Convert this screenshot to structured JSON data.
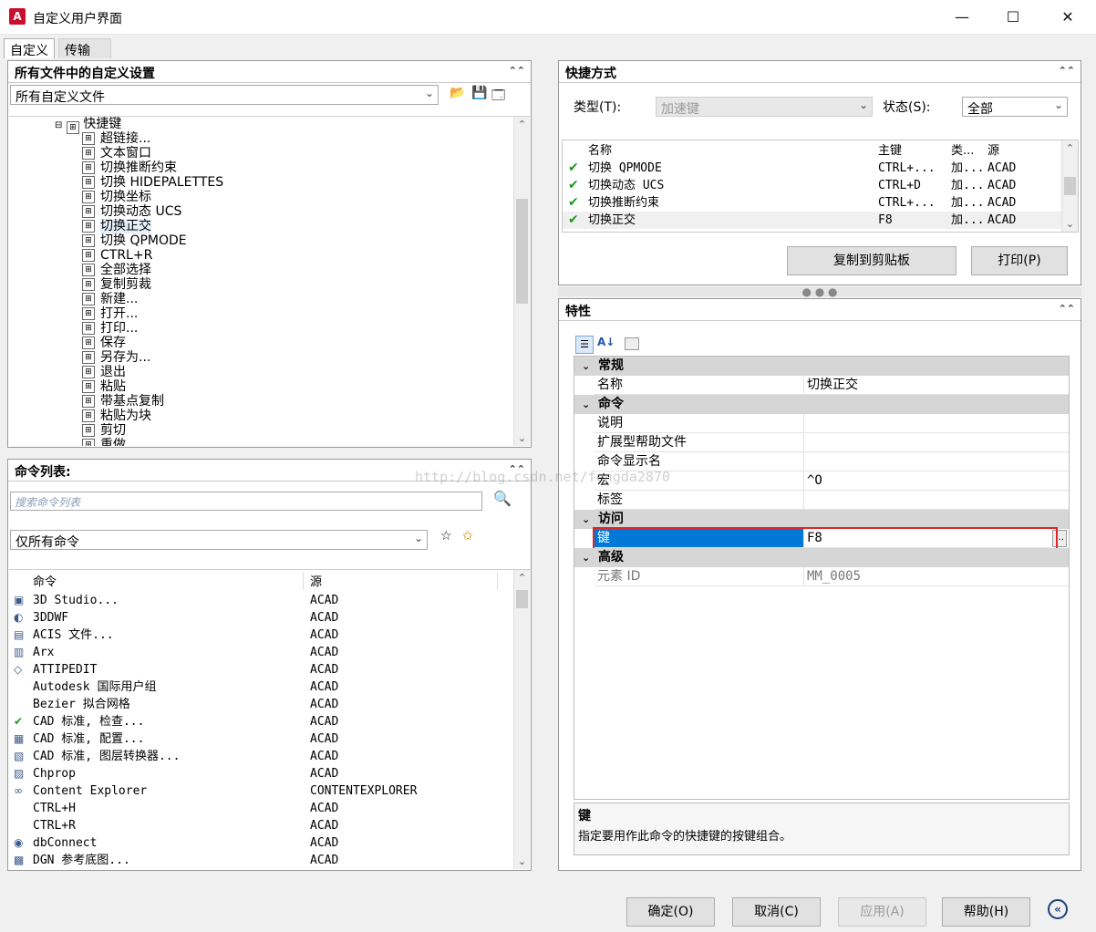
{
  "window": {
    "title": "自定义用户界面"
  },
  "tabs": [
    {
      "label": "自定义"
    },
    {
      "label": "传输"
    }
  ],
  "customizations": {
    "header": "所有文件中的自定义设置",
    "filter_value": "所有自定义文件",
    "tree_root": "快捷键",
    "tree_items": [
      "超链接...",
      "文本窗口",
      "切换推断约束",
      "切换 HIDEPALETTES",
      "切换坐标",
      "切换动态 UCS",
      "切换正交",
      "切换 QPMODE",
      "CTRL+R",
      "全部选择",
      "复制剪裁",
      "新建...",
      "打开...",
      "打印...",
      "保存",
      "另存为...",
      "退出",
      "粘贴",
      "带基点复制",
      "粘贴为块",
      "剪切",
      "重做"
    ]
  },
  "command_list": {
    "header": "命令列表:",
    "search_placeholder": "搜索命令列表",
    "filter_value": "仅所有命令",
    "col_command": "命令",
    "col_source": "源",
    "rows": [
      {
        "name": "3D Studio...",
        "source": "ACAD",
        "icon": "3dstudio-icon"
      },
      {
        "name": "3DDWF",
        "source": "ACAD",
        "icon": "3ddwf-icon"
      },
      {
        "name": "ACIS 文件...",
        "source": "ACAD",
        "icon": "acis-icon"
      },
      {
        "name": "Arx",
        "source": "ACAD",
        "icon": "arx-icon"
      },
      {
        "name": "ATTIPEDIT",
        "source": "ACAD",
        "icon": "attipedit-icon"
      },
      {
        "name": "Autodesk 国际用户组",
        "source": "ACAD",
        "icon": ""
      },
      {
        "name": "Bezier 拟合网格",
        "source": "ACAD",
        "icon": ""
      },
      {
        "name": "CAD 标准, 检查...",
        "source": "ACAD",
        "icon": "check-icon"
      },
      {
        "name": "CAD 标准, 配置...",
        "source": "ACAD",
        "icon": "configure-icon"
      },
      {
        "name": "CAD 标准, 图层转换器...",
        "source": "ACAD",
        "icon": "layer-translator-icon"
      },
      {
        "name": "Chprop",
        "source": "ACAD",
        "icon": "chprop-icon"
      },
      {
        "name": "Content Explorer",
        "source": "CONTENTEXPLORER",
        "icon": "binoculars-icon"
      },
      {
        "name": "CTRL+H",
        "source": "ACAD",
        "icon": ""
      },
      {
        "name": "CTRL+R",
        "source": "ACAD",
        "icon": ""
      },
      {
        "name": "dbConnect",
        "source": "ACAD",
        "icon": "dbconnect-icon"
      },
      {
        "name": "DGN 参考底图...",
        "source": "ACAD",
        "icon": "dgn-icon"
      }
    ]
  },
  "shortcuts": {
    "header": "快捷方式",
    "type_label": "类型(T):",
    "type_value": "加速键",
    "status_label": "状态(S):",
    "status_value": "全部",
    "col_name": "名称",
    "col_key": "主键",
    "col_type": "类...",
    "col_source": "源",
    "rows": [
      {
        "name": "切换 QPMODE",
        "key": "CTRL+...",
        "type": "加...",
        "source": "ACAD"
      },
      {
        "name": "切换动态 UCS",
        "key": "CTRL+D",
        "type": "加...",
        "source": "ACAD"
      },
      {
        "name": "切换推断约束",
        "key": "CTRL+...",
        "type": "加...",
        "source": "ACAD"
      },
      {
        "name": "切换正交",
        "key": "F8",
        "type": "加...",
        "source": "ACAD"
      }
    ],
    "copy_button": "复制到剪贴板",
    "print_button": "打印(P)"
  },
  "properties": {
    "header": "特性",
    "cat_general": "常规",
    "name_label": "名称",
    "name_value": "切换正交",
    "cat_command": "命令",
    "description_label": "说明",
    "description_value": "",
    "help_file_label": "扩展型帮助文件",
    "help_file_value": "",
    "display_name_label": "命令显示名",
    "display_name_value": "",
    "macro_label": "宏",
    "macro_value": "^O",
    "tag_label": "标签",
    "tag_value": "",
    "cat_access": "访问",
    "key_label": "键",
    "key_value": "F8",
    "cat_advanced": "高级",
    "element_id_label": "元素 ID",
    "element_id_value": "MM_0005",
    "help_title": "键",
    "help_text": "指定要用作此命令的快捷键的按键组合。"
  },
  "footer": {
    "ok": "确定(O)",
    "cancel": "取消(C)",
    "apply": "应用(A)",
    "help": "帮助(H)"
  },
  "watermark": "http://blog.csdn.net/fengda2870",
  "colors": {
    "selection": "#0078d7",
    "highlight_border": "#e0242a",
    "check": "#1a9a1a"
  }
}
